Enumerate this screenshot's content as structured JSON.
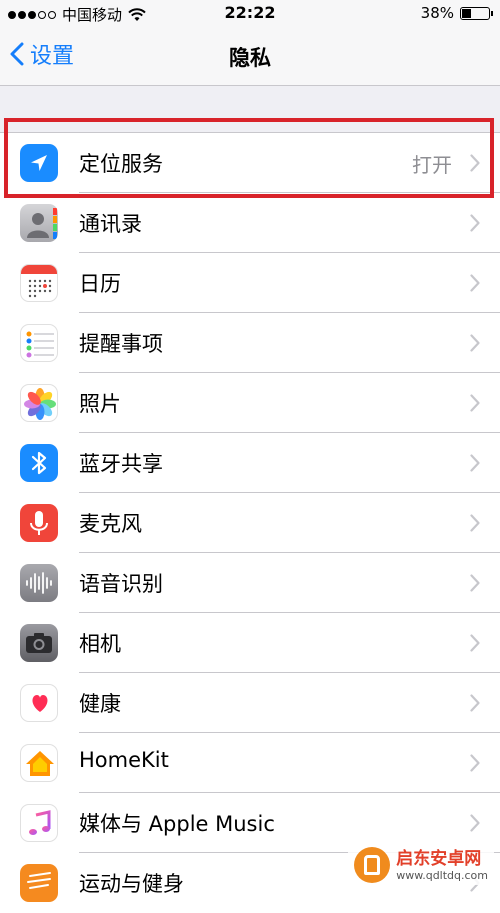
{
  "status_bar": {
    "carrier": "中国移动",
    "time": "22:22",
    "battery": "38%",
    "battery_level": 0.38
  },
  "nav": {
    "back_label": "设置",
    "title": "隐私"
  },
  "rows": [
    {
      "label": "定位服务",
      "value": "打开",
      "icon": "location-arrow-icon",
      "color": "#1a8cff"
    },
    {
      "label": "通讯录",
      "icon": "contacts-icon",
      "color": "#a8a8ad"
    },
    {
      "label": "日历",
      "icon": "calendar-icon",
      "color": "#ffffff"
    },
    {
      "label": "提醒事项",
      "icon": "reminders-icon",
      "color": "#ffffff"
    },
    {
      "label": "照片",
      "icon": "photos-icon",
      "color": "#ffffff"
    },
    {
      "label": "蓝牙共享",
      "icon": "bluetooth-icon",
      "color": "#1a8cff"
    },
    {
      "label": "麦克风",
      "icon": "microphone-icon",
      "color": "#f0453a"
    },
    {
      "label": "语音识别",
      "icon": "speech-recognition-icon",
      "color": "#8e8e93"
    },
    {
      "label": "相机",
      "icon": "camera-icon",
      "color": "#6d6d72"
    },
    {
      "label": "健康",
      "icon": "health-heart-icon",
      "color": "#ffffff"
    },
    {
      "label": "HomeKit",
      "icon": "homekit-house-icon",
      "color": "#ffffff"
    },
    {
      "label": "媒体与 Apple Music",
      "icon": "music-note-icon",
      "color": "#ffffff"
    },
    {
      "label": "运动与健身",
      "icon": "motion-fitness-icon",
      "color": "#f58a1f"
    }
  ],
  "watermark": {
    "brand": "启东安卓网",
    "url": "www.qdltdq.com"
  },
  "colors": {
    "accent": "#157efb",
    "highlight": "#d8232a",
    "background": "#efeff4"
  }
}
